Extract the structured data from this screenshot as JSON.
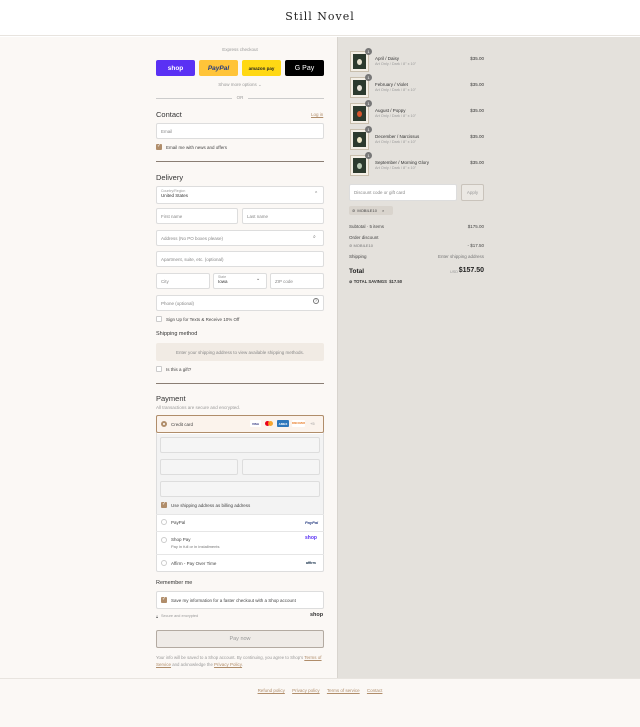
{
  "brand": "Still Novel",
  "express": {
    "label": "Express checkout",
    "buttons": [
      "shop",
      "PayPal",
      "amazon pay",
      "G Pay"
    ],
    "show_more": "Show more options",
    "or": "OR"
  },
  "contact": {
    "title": "Contact",
    "login": "Log in",
    "email_placeholder": "Email",
    "news_label": "Email me with news and offers"
  },
  "delivery": {
    "title": "Delivery",
    "country_label": "Country/Region",
    "country_value": "United States",
    "first_name": "First name",
    "last_name": "Last name",
    "address": "Address (No PO boxes please)",
    "apartment": "Apartment, suite, etc. (optional)",
    "city": "City",
    "state_label": "State",
    "state_value": "Iowa",
    "zip": "ZIP code",
    "phone": "Phone (optional)",
    "sms_label": "Sign Up for Texts & Receive 10% Off"
  },
  "shipping": {
    "title": "Shipping method",
    "notice": "Enter your shipping address to view available shipping methods.",
    "gift_label": "Is this a gift?"
  },
  "payment": {
    "title": "Payment",
    "subtitle": "All transactions are secure and encrypted.",
    "credit_card": "Credit card",
    "card_logos": [
      "VISA",
      "MC",
      "AMEX",
      "DISCOVER"
    ],
    "more_cards": "+5",
    "billing_label": "Use shipping address as billing address",
    "paypal": "PayPal",
    "shop_pay": "Shop Pay",
    "shop_pay_sub": "Pay in full or in installments",
    "affirm": "Affirm - Pay Over Time",
    "paypal_logo": "PayPal",
    "shop_logo": "shop",
    "affirm_logo": "affirm"
  },
  "remember": {
    "title": "Remember me",
    "save_label": "Save my information for a faster checkout with a Shop account",
    "secure": "Secure and encrypted",
    "shop_logo": "shop"
  },
  "pay_now": "Pay now",
  "legal": {
    "text_before": "Your info will be saved to a Shop account. By continuing, you agree to Shop's",
    "terms": "Terms of Service",
    "and": "and acknowledge the",
    "privacy": "Privacy Policy",
    "end": "."
  },
  "footer": {
    "links": [
      "Refund policy",
      "Privacy policy",
      "Terms of service",
      "Contact"
    ]
  },
  "cart": {
    "items": [
      {
        "name": "April / Daisy",
        "variant": "Art Only / Dark / 8\" x 10\"",
        "price": "$35.00",
        "qty": "1",
        "flower_color": "#e8e2cf"
      },
      {
        "name": "February / Violet",
        "variant": "Art Only / Dark / 8\" x 10\"",
        "price": "$35.00",
        "qty": "1",
        "flower_color": "#e9e4da"
      },
      {
        "name": "August / Poppy",
        "variant": "Art Only / Dark / 8\" x 10\"",
        "price": "$35.00",
        "qty": "1",
        "flower_color": "#d8552c"
      },
      {
        "name": "December / Narcissus",
        "variant": "Art Only / Dark / 8\" x 10\"",
        "price": "$35.00",
        "qty": "1",
        "flower_color": "#efe8c8"
      },
      {
        "name": "September / Morning Glory",
        "variant": "Art Only / Dark / 8\" x 10\"",
        "price": "$35.00",
        "qty": "1",
        "flower_color": "#b9c9b4"
      }
    ],
    "discount_placeholder": "Discount code or gift card",
    "apply": "Apply",
    "code": "MOBILE10",
    "subtotal_label": "Subtotal · 5 items",
    "subtotal_value": "$175.00",
    "order_discount_label": "Order discount",
    "order_discount_code": "MOBILE10",
    "order_discount_value": "- $17.50",
    "shipping_label": "Shipping",
    "shipping_value": "Enter shipping address",
    "total_label": "Total",
    "currency": "USD",
    "total_value": "$157.50",
    "savings_label": "TOTAL SAVINGS",
    "savings_value": "$17.50"
  }
}
